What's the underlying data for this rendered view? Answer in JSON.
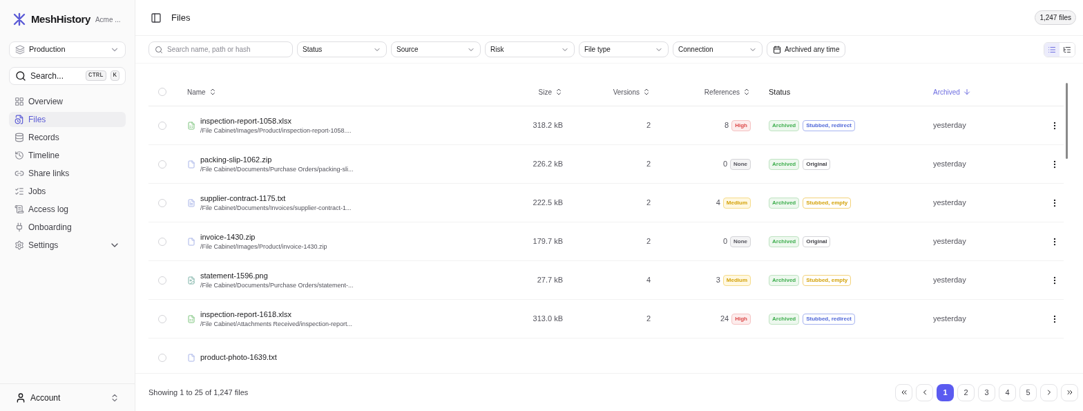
{
  "brand": {
    "name": "MeshHistory",
    "org": "Acme ..."
  },
  "environment": {
    "value": "Production"
  },
  "search": {
    "placeholder": "Search...",
    "keys": [
      "CTRL",
      "K"
    ]
  },
  "nav": [
    {
      "label": "Overview",
      "kind": "link",
      "selected": false
    },
    {
      "label": "Files",
      "kind": "link",
      "selected": true
    },
    {
      "label": "Records",
      "kind": "link",
      "selected": false
    },
    {
      "label": "Timeline",
      "kind": "link",
      "selected": false
    },
    {
      "label": "Share links",
      "kind": "link",
      "selected": false
    },
    {
      "label": "Jobs",
      "kind": "link",
      "selected": false
    },
    {
      "label": "Access log",
      "kind": "link",
      "selected": false
    },
    {
      "label": "Onboarding",
      "kind": "link",
      "selected": false
    },
    {
      "label": "Settings",
      "kind": "group",
      "selected": false
    }
  ],
  "account": {
    "label": "Account"
  },
  "header": {
    "title": "Files",
    "count": "1,247 files"
  },
  "filters": {
    "search_placeholder": "Search name, path or hash",
    "dropdowns": [
      "Status",
      "Source",
      "Risk",
      "File type",
      "Connection"
    ],
    "date": "Archived any time",
    "view_modes": [
      {
        "selected": true
      },
      {
        "selected": false
      }
    ]
  },
  "table": {
    "select_all": {
      "checked": false
    },
    "columns": [
      {
        "label": "Name",
        "kind": "sortable",
        "sorted": false
      },
      {
        "label": "Size",
        "kind": "sortable",
        "sorted": false
      },
      {
        "label": "Versions",
        "kind": "sortable",
        "sorted": false
      },
      {
        "label": "References",
        "kind": "sortable",
        "sorted": false
      },
      {
        "label": "Status",
        "kind": "plain",
        "sorted": false
      },
      {
        "label": "Archived",
        "kind": "sortable",
        "sorted": true
      }
    ],
    "rows": [
      {
        "checked": false,
        "name": "inspection-report-1058.xlsx",
        "path": "/File Cabinet/Images/Product/inspection-report-1058....",
        "kind": "spreadsheet",
        "size": "318.2 kB",
        "versions": "2",
        "references": "8",
        "risk": {
          "label": "High",
          "kind": "high"
        },
        "status": "Archived",
        "stub": {
          "label": "Stubbed, redirect",
          "kind": "redirect"
        },
        "archived": "yesterday"
      },
      {
        "checked": false,
        "name": "packing-slip-1062.zip",
        "path": "/File Cabinet/Documents/Purchase Orders/packing-sli...",
        "kind": "document",
        "size": "226.2 kB",
        "versions": "2",
        "references": "0",
        "risk": {
          "label": "None",
          "kind": "none"
        },
        "status": "Archived",
        "stub": {
          "label": "Original",
          "kind": "original"
        },
        "archived": "yesterday"
      },
      {
        "checked": false,
        "name": "supplier-contract-1175.txt",
        "path": "/File Cabinet/Documents/Invoices/supplier-contract-1...",
        "kind": "text",
        "size": "222.5 kB",
        "versions": "2",
        "references": "4",
        "risk": {
          "label": "Medium",
          "kind": "medium"
        },
        "status": "Archived",
        "stub": {
          "label": "Stubbed, empty",
          "kind": "empty"
        },
        "archived": "yesterday"
      },
      {
        "checked": false,
        "name": "invoice-1430.zip",
        "path": "/File Cabinet/Images/Product/invoice-1430.zip",
        "kind": "document",
        "size": "179.7 kB",
        "versions": "2",
        "references": "0",
        "risk": {
          "label": "None",
          "kind": "none"
        },
        "status": "Archived",
        "stub": {
          "label": "Original",
          "kind": "original"
        },
        "archived": "yesterday"
      },
      {
        "checked": false,
        "name": "statement-1596.png",
        "path": "/File Cabinet/Documents/Purchase Orders/statement-...",
        "kind": "image",
        "size": "27.7 kB",
        "versions": "4",
        "references": "3",
        "risk": {
          "label": "Medium",
          "kind": "medium"
        },
        "status": "Archived",
        "stub": {
          "label": "Stubbed, empty",
          "kind": "empty"
        },
        "archived": "yesterday"
      },
      {
        "checked": false,
        "name": "inspection-report-1618.xlsx",
        "path": "/File Cabinet/Attachments Received/inspection-report...",
        "kind": "spreadsheet",
        "size": "313.0 kB",
        "versions": "2",
        "references": "24",
        "risk": {
          "label": "High",
          "kind": "high"
        },
        "status": "Archived",
        "stub": {
          "label": "Stubbed, redirect",
          "kind": "redirect"
        },
        "archived": "yesterday"
      },
      {
        "checked": false,
        "name": "product-photo-1639.txt",
        "kind": "document"
      }
    ]
  },
  "footer": {
    "summary": "Showing 1 to 25 of 1,247 files",
    "pages": [
      {
        "label": "1",
        "selected": true
      },
      {
        "label": "2",
        "selected": false
      },
      {
        "label": "3",
        "selected": false
      },
      {
        "label": "4",
        "selected": false
      },
      {
        "label": "5",
        "selected": false
      }
    ]
  }
}
